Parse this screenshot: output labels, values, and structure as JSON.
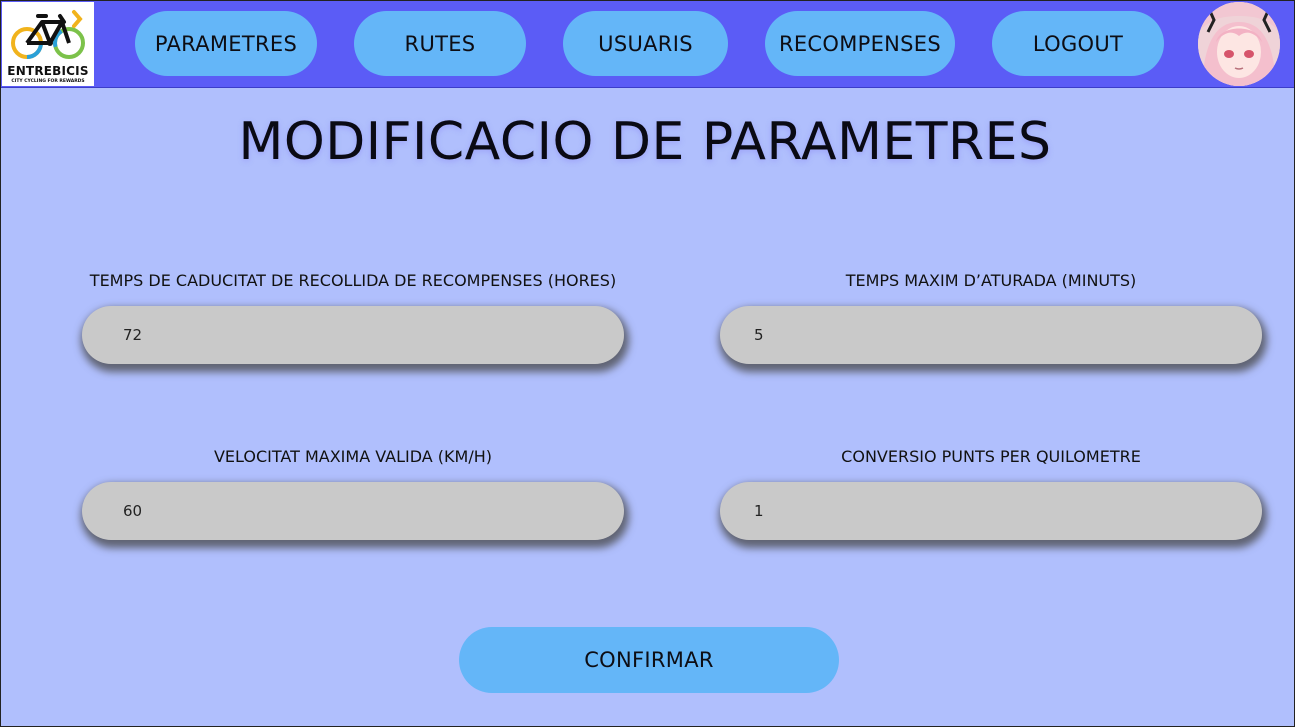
{
  "brand": {
    "name": "ENTREBICIS",
    "tagline": "CITY CYCLING FOR REWARDS"
  },
  "nav": {
    "items": [
      {
        "label": "PARAMETRES"
      },
      {
        "label": "RUTES"
      },
      {
        "label": "USUARIS"
      },
      {
        "label": "RECOMPENSES"
      },
      {
        "label": "LOGOUT"
      }
    ]
  },
  "page": {
    "title": "MODIFICACIO DE PARAMETRES"
  },
  "fields": [
    {
      "label": "TEMPS DE CADUCITAT DE RECOLLIDA DE RECOMPENSES (HORES)",
      "value": "72"
    },
    {
      "label": "TEMPS MAXIM D’ATURADA (MINUTS)",
      "value": "5"
    },
    {
      "label": "VELOCITAT MAXIMA VALIDA (KM/H)",
      "value": "60"
    },
    {
      "label": "CONVERSIO PUNTS PER QUILOMETRE",
      "value": "1"
    }
  ],
  "actions": {
    "confirm_label": "CONFIRMAR"
  },
  "colors": {
    "topbar": "#5b5cf6",
    "background": "#b0bffd",
    "button": "#64b6f8",
    "input": "#c9c9c9"
  }
}
